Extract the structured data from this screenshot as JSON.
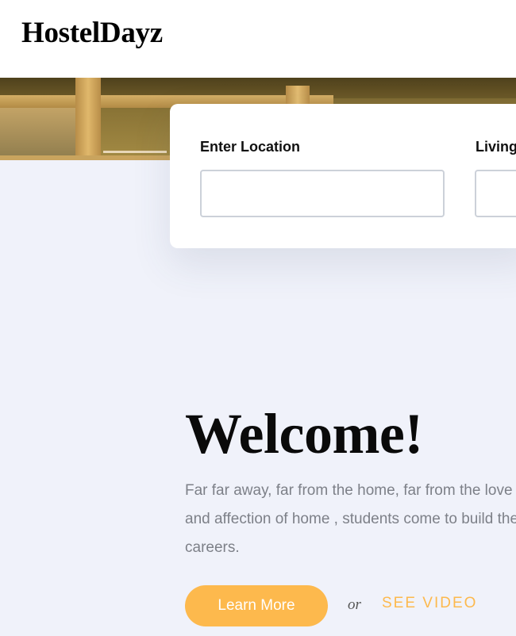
{
  "header": {
    "logo": "HostelDayz"
  },
  "search": {
    "location_label": "Enter Location",
    "location_value": "",
    "living_label": "Living",
    "living_value": ""
  },
  "welcome": {
    "title": "Welcome!",
    "text": "Far far away, far from the home, far from the love and affection of home , students come to build their careers.",
    "learn_more_label": "Learn More",
    "or_text": "or",
    "see_video_label": "SEE VIDEO"
  },
  "colors": {
    "accent": "#fdb94d",
    "background": "#f0f2fa",
    "text_muted": "#7d8088"
  }
}
